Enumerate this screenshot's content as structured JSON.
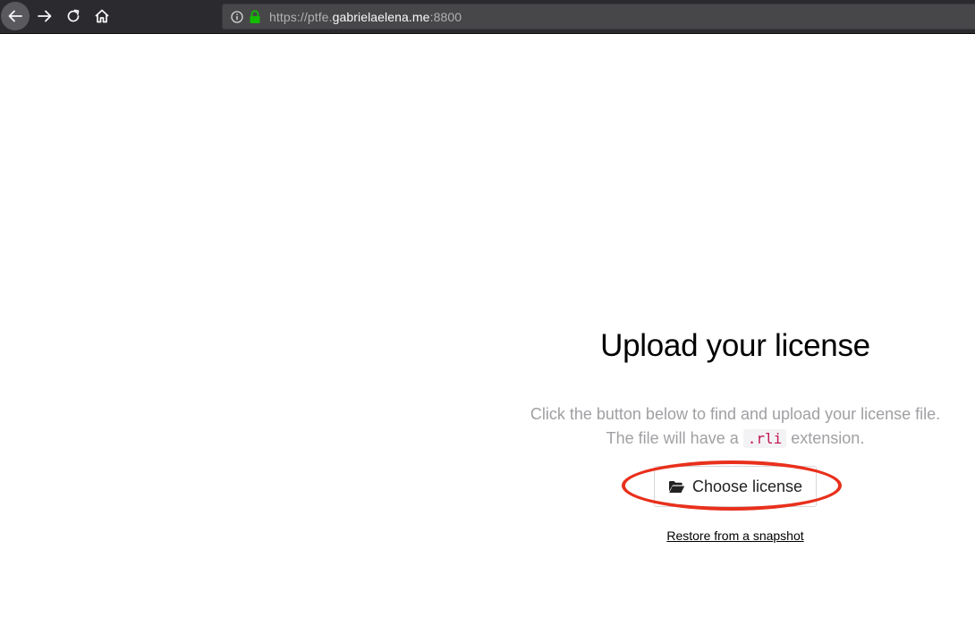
{
  "browser": {
    "url_prefix": "https://ptfe.",
    "url_host": "gabrielaelena.me",
    "url_suffix": ":8800"
  },
  "page": {
    "title": "Upload your license",
    "description_line1": "Click the button below to find and upload your license file.",
    "description_line2_before": "The file will have a ",
    "description_code": ".rli",
    "description_line2_after": " extension.",
    "choose_button_label": "Choose license",
    "restore_link_label": "Restore from a snapshot"
  },
  "colors": {
    "toolbar_bg": "#2b2a2f",
    "highlight_ring": "#e8301c",
    "secure_lock": "#12bc00",
    "code_text": "#c0174d"
  },
  "icons": {
    "back": "arrow-left-icon",
    "forward": "arrow-right-icon",
    "reload": "reload-icon",
    "home": "home-icon",
    "info": "info-icon",
    "lock": "lock-icon",
    "folder": "folder-open-icon"
  }
}
